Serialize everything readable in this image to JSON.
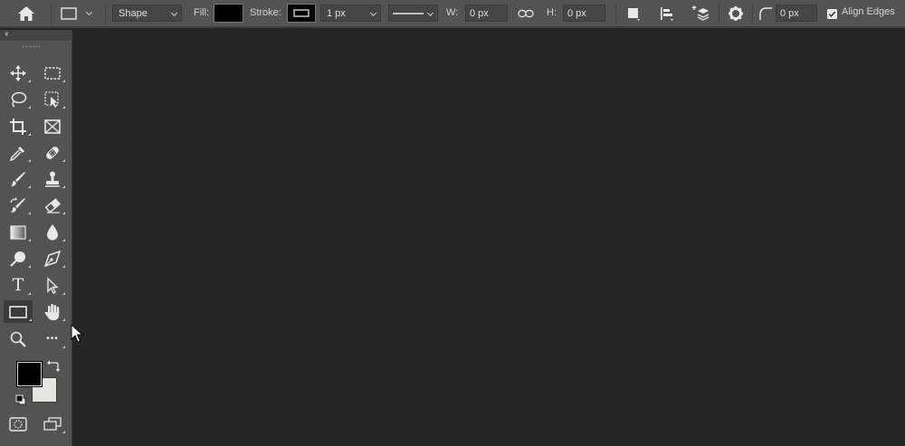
{
  "options_bar": {
    "mode_select": "Shape",
    "fill_label": "Fill:",
    "fill_color": "#000000",
    "stroke_label": "Stroke:",
    "stroke_width": "1 px",
    "width_label": "W:",
    "width_value": "0 px",
    "height_label": "H:",
    "height_value": "0 px",
    "corner_radius": "0 px",
    "align_edges_label": "Align Edges",
    "align_edges_checked": true
  },
  "toolbar": {
    "collapse_label": "‹‹",
    "tools": [
      {
        "name": "move-tool",
        "icon": "move-icon"
      },
      {
        "name": "rectangular-marquee-tool",
        "icon": "marquee-icon"
      },
      {
        "name": "lasso-tool",
        "icon": "lasso-icon"
      },
      {
        "name": "object-selection-tool",
        "icon": "object-selection-icon"
      },
      {
        "name": "crop-tool",
        "icon": "crop-icon"
      },
      {
        "name": "frame-tool",
        "icon": "frame-icon"
      },
      {
        "name": "eyedropper-tool",
        "icon": "eyedropper-icon"
      },
      {
        "name": "healing-brush-tool",
        "icon": "bandage-icon"
      },
      {
        "name": "brush-tool",
        "icon": "brush-icon"
      },
      {
        "name": "clone-stamp-tool",
        "icon": "stamp-icon"
      },
      {
        "name": "history-brush-tool",
        "icon": "history-brush-icon"
      },
      {
        "name": "eraser-tool",
        "icon": "eraser-icon"
      },
      {
        "name": "gradient-tool",
        "icon": "gradient-icon"
      },
      {
        "name": "blur-tool",
        "icon": "drop-icon"
      },
      {
        "name": "dodge-tool",
        "icon": "dodge-icon"
      },
      {
        "name": "pen-tool",
        "icon": "pen-icon"
      },
      {
        "name": "type-tool",
        "icon": "type-icon",
        "glyph": "T"
      },
      {
        "name": "path-selection-tool",
        "icon": "arrow-icon"
      },
      {
        "name": "rectangle-tool",
        "icon": "rectangle-icon",
        "active": true
      },
      {
        "name": "hand-tool",
        "icon": "hand-icon"
      },
      {
        "name": "zoom-tool",
        "icon": "zoom-icon"
      },
      {
        "name": "edit-toolbar",
        "icon": "more-icon",
        "glyph": "•••"
      }
    ],
    "foreground_color": "#000000",
    "background_color": "#e6e4de"
  }
}
